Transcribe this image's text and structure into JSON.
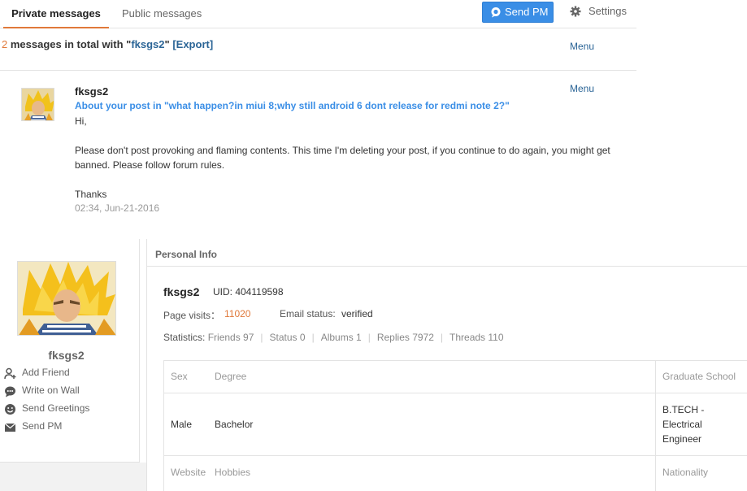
{
  "tabs": {
    "private": "Private messages",
    "public": "Public messages"
  },
  "toolbar": {
    "send_pm": "Send PM",
    "settings": "Settings"
  },
  "summary": {
    "count": "2",
    "text_before_user": " messages in total with \"",
    "user": "fksgs2",
    "text_after_user": "\"",
    "export": "[Export]",
    "menu": "Menu"
  },
  "message": {
    "menu": "Menu",
    "sender": "fksgs2",
    "subject": "About your post in \"what happen?in miui 8;why still android 6 dont release for redmi note 2?\"",
    "lines": [
      "Hi,",
      "Please don't post provoking and flaming contents. This time I'm deleting your post, if you continue to do again, you might get",
      "banned. Please follow forum rules.",
      "Thanks"
    ],
    "time": "02:34, Jun-21-2016"
  },
  "profile": {
    "name": "fksgs2",
    "actions": [
      {
        "label": "Add Friend",
        "icon": "add-friend-icon"
      },
      {
        "label": "Write on Wall",
        "icon": "speech-bubble-icon"
      },
      {
        "label": "Send Greetings",
        "icon": "smiley-icon"
      },
      {
        "label": "Send PM",
        "icon": "envelope-icon"
      }
    ]
  },
  "personal_info": {
    "title": "Personal Info",
    "name": "fksgs2",
    "uid": "UID: 404119598",
    "visits_label": "Page visits：",
    "visits_value": "11020",
    "email_label": "Email status:",
    "email_value": "verified",
    "stats_label": "Statistics:",
    "stats": [
      "Friends 97",
      "Status 0",
      "Albums 1",
      "Replies 7972",
      "Threads 110"
    ],
    "table": {
      "row1_headers": [
        "Sex",
        "Degree",
        "Graduate School"
      ],
      "row1_values": [
        "Male",
        "Bachelor"
      ],
      "school_lines": [
        "B.TECH -",
        "Electrical",
        "Engineer"
      ],
      "row2_headers": [
        "Website",
        "Hobbies",
        "Nationality"
      ]
    }
  },
  "colors": {
    "accent_orange": "#e0793a",
    "link_blue": "#2a6496",
    "subject_blue": "#3a8ee6",
    "button_blue": "#3a8ee6"
  }
}
